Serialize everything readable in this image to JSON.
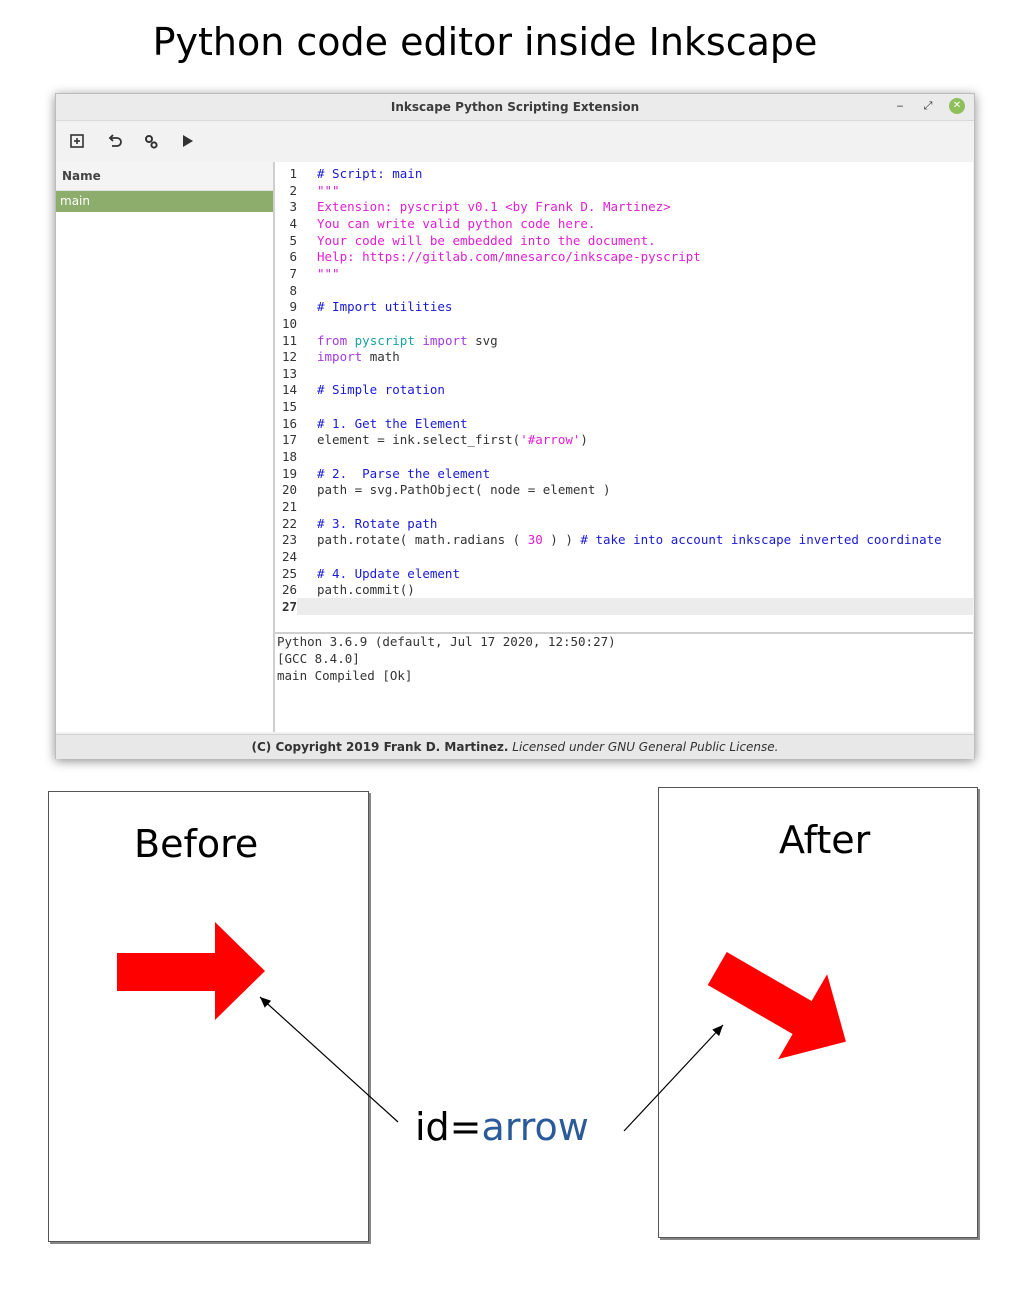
{
  "heading": "Python code editor inside Inkscape",
  "window": {
    "title": "Inkscape Python Scripting Extension",
    "controls": {
      "minimize": "‒",
      "maximize": "⤢",
      "close": "✕"
    }
  },
  "toolbar": {
    "icons": [
      "new-script-icon",
      "undo-icon",
      "settings-icon",
      "run-icon"
    ]
  },
  "sidebar": {
    "header": "Name",
    "items": [
      {
        "label": "main",
        "selected": true
      }
    ]
  },
  "editor": {
    "current_line": 27,
    "lines": [
      {
        "n": "1",
        "segs": [
          {
            "t": "# Script: main",
            "c": "comment"
          }
        ]
      },
      {
        "n": "2",
        "segs": [
          {
            "t": "\"\"\"",
            "c": "doc"
          }
        ]
      },
      {
        "n": "3",
        "segs": [
          {
            "t": "Extension: pyscript v0.1 <by Frank D. Martinez>",
            "c": "doc"
          }
        ]
      },
      {
        "n": "4",
        "segs": [
          {
            "t": "You can write valid python code here.",
            "c": "doc"
          }
        ]
      },
      {
        "n": "5",
        "segs": [
          {
            "t": "Your code will be embedded into the document.",
            "c": "doc"
          }
        ]
      },
      {
        "n": "6",
        "segs": [
          {
            "t": "Help: https://gitlab.com/mnesarco/inkscape-pyscript",
            "c": "doc"
          }
        ]
      },
      {
        "n": "7",
        "segs": [
          {
            "t": "\"\"\"",
            "c": "doc"
          }
        ]
      },
      {
        "n": "8",
        "segs": []
      },
      {
        "n": "9",
        "segs": [
          {
            "t": "# Import utilities",
            "c": "comment"
          }
        ]
      },
      {
        "n": "10",
        "segs": []
      },
      {
        "n": "11",
        "segs": [
          {
            "t": "from ",
            "c": "kw"
          },
          {
            "t": "pyscript",
            "c": "mod"
          },
          {
            "t": " import ",
            "c": "kw"
          },
          {
            "t": "svg",
            "c": "plain"
          }
        ]
      },
      {
        "n": "12",
        "segs": [
          {
            "t": "import ",
            "c": "kw"
          },
          {
            "t": "math",
            "c": "plain"
          }
        ]
      },
      {
        "n": "13",
        "segs": []
      },
      {
        "n": "14",
        "segs": [
          {
            "t": "# Simple rotation",
            "c": "comment"
          }
        ]
      },
      {
        "n": "15",
        "segs": []
      },
      {
        "n": "16",
        "segs": [
          {
            "t": "# 1. Get the Element",
            "c": "comment"
          }
        ]
      },
      {
        "n": "17",
        "segs": [
          {
            "t": "element = ink.select_first(",
            "c": "plain"
          },
          {
            "t": "'#arrow'",
            "c": "str"
          },
          {
            "t": ")",
            "c": "plain"
          }
        ]
      },
      {
        "n": "18",
        "segs": []
      },
      {
        "n": "19",
        "segs": [
          {
            "t": "# 2.  Parse the element",
            "c": "comment"
          }
        ]
      },
      {
        "n": "20",
        "segs": [
          {
            "t": "path = svg.PathObject( node = element )",
            "c": "plain"
          }
        ]
      },
      {
        "n": "21",
        "segs": []
      },
      {
        "n": "22",
        "segs": [
          {
            "t": "# 3. Rotate path",
            "c": "comment"
          }
        ]
      },
      {
        "n": "23",
        "segs": [
          {
            "t": "path.rotate( math.radians ( ",
            "c": "plain"
          },
          {
            "t": "30",
            "c": "num"
          },
          {
            "t": " ) ) ",
            "c": "plain"
          },
          {
            "t": "# take into account inkscape inverted coordinate",
            "c": "comment"
          }
        ]
      },
      {
        "n": "24",
        "segs": []
      },
      {
        "n": "25",
        "segs": [
          {
            "t": "# 4. Update element",
            "c": "comment"
          }
        ]
      },
      {
        "n": "26",
        "segs": [
          {
            "t": "path.commit()",
            "c": "plain"
          }
        ]
      },
      {
        "n": "27",
        "segs": []
      }
    ]
  },
  "console": {
    "lines": [
      "Python 3.6.9 (default, Jul 17 2020, 12:50:27)",
      "[GCC 8.4.0]",
      "main Compiled [Ok]"
    ]
  },
  "statusbar": {
    "copyright": "(C) Copyright 2019 Frank D. Martinez.",
    "license": "Licensed under GNU General Public License."
  },
  "panels": {
    "before": {
      "title": "Before"
    },
    "after": {
      "title": "After"
    },
    "arrow_rotation_degrees": 30
  },
  "label": {
    "key": "id=",
    "value": "arrow"
  },
  "colors": {
    "arrow": "#ff0000",
    "selection": "#8cad6c",
    "comment": "#1a1ad6",
    "docstring": "#e01fd0",
    "keyword": "#a23be0",
    "module": "#1aa3a3",
    "id_value": "#2a5a9a"
  }
}
